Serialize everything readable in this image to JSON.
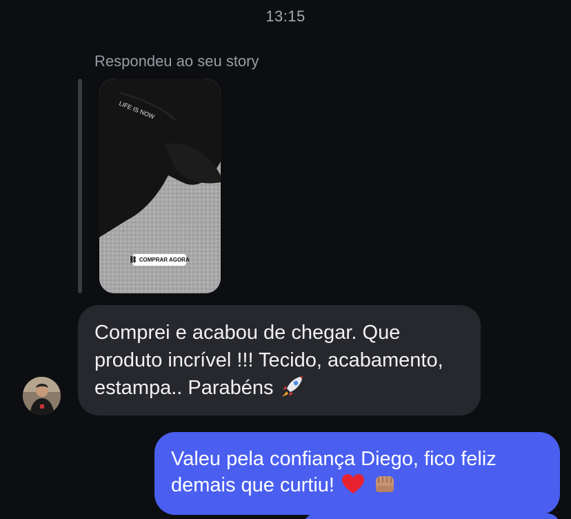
{
  "header": {
    "time": "13:15"
  },
  "reply_context": {
    "label": "Respondeu ao seu story",
    "story": {
      "shirt_text": "LIFE IS NOW",
      "link_label": "COMPRAR AGORA",
      "link_icon": "link-icon"
    }
  },
  "messages": {
    "incoming": {
      "text_main": "Comprei e acabou de chegar. Que produto incrível !!! Tecido, acabamento, estampa.. Parabéns",
      "emoji": "rocket-emoji"
    },
    "outgoing": {
      "text_main": "Valeu pela confiança Diego, fico feliz demais que curtiu!",
      "emojis": [
        "red-heart-emoji",
        "fist-bump-emoji"
      ]
    }
  },
  "colors": {
    "background": "#0d0e12",
    "incoming_bubble": "#26282e",
    "outgoing_bubble": "#4a5ff0",
    "timestamp_text": "#a8aab0"
  }
}
